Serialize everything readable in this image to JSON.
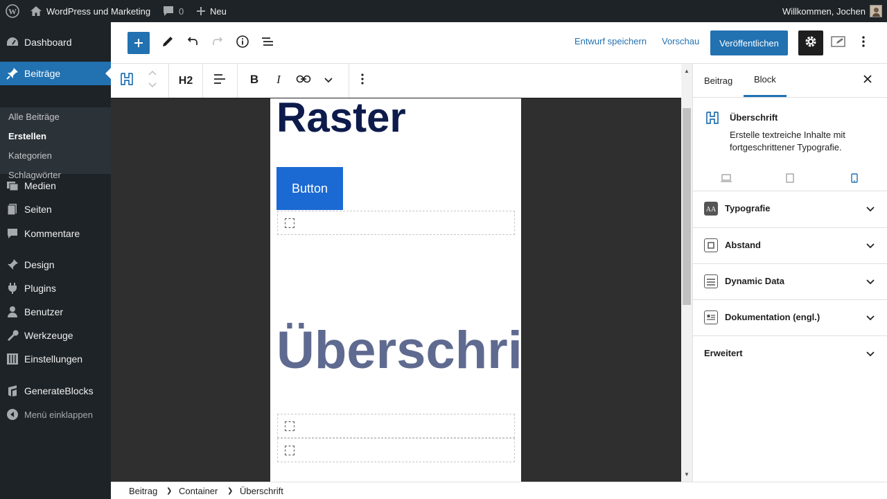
{
  "admin_bar": {
    "site_name": "WordPress und Marketing",
    "comments_count": "0",
    "new_label": "Neu",
    "greeting": "Willkommen, Jochen"
  },
  "admin_menu": {
    "items": [
      {
        "label": "Dashboard",
        "icon": "dashboard-icon"
      },
      {
        "label": "Beiträge",
        "icon": "pin-icon"
      },
      {
        "label": "Medien",
        "icon": "media-icon"
      },
      {
        "label": "Seiten",
        "icon": "pages-icon"
      },
      {
        "label": "Kommentare",
        "icon": "comments-icon"
      },
      {
        "label": "Design",
        "icon": "brush-icon"
      },
      {
        "label": "Plugins",
        "icon": "plug-icon"
      },
      {
        "label": "Benutzer",
        "icon": "user-icon"
      },
      {
        "label": "Werkzeuge",
        "icon": "wrench-icon"
      },
      {
        "label": "Einstellungen",
        "icon": "settings-sliders-icon"
      },
      {
        "label": "GenerateBlocks",
        "icon": "generateblocks-icon"
      },
      {
        "label": "Menü einklappen",
        "icon": "collapse-icon"
      }
    ],
    "submenu": [
      {
        "label": "Alle Beiträge"
      },
      {
        "label": "Erstellen"
      },
      {
        "label": "Kategorien"
      },
      {
        "label": "Schlagwörter"
      }
    ]
  },
  "header": {
    "save_draft": "Entwurf speichern",
    "preview": "Vorschau",
    "publish": "Veröffentlichen"
  },
  "block_toolbar": {
    "heading_level": "H2"
  },
  "canvas": {
    "heading_top": "Raster",
    "button_label": "Button",
    "heading_main": "Überschrift"
  },
  "sidebar": {
    "tabs": [
      {
        "label": "Beitrag"
      },
      {
        "label": "Block"
      }
    ],
    "active_tab": "Block",
    "block_card": {
      "title": "Überschrift",
      "description": "Erstelle textreiche Inhalte mit fortgeschrittener Typografie."
    },
    "panels": [
      {
        "label": "Typografie",
        "icon": "typography-icon"
      },
      {
        "label": "Abstand",
        "icon": "spacing-icon"
      },
      {
        "label": "Dynamic Data",
        "icon": "database-icon"
      },
      {
        "label": "Dokumentation (engl.)",
        "icon": "documentation-icon"
      },
      {
        "label": "Erweitert"
      }
    ]
  },
  "breadcrumb": [
    "Beitrag",
    "Container",
    "Überschrift"
  ],
  "colors": {
    "admin_dark": "#1d2327",
    "accent": "#2271b1",
    "button_blue": "#1b69d3",
    "heading_navy": "#0d1b4c",
    "heading_slate": "#5f6a90",
    "canvas_bg": "#2f2f2f"
  }
}
